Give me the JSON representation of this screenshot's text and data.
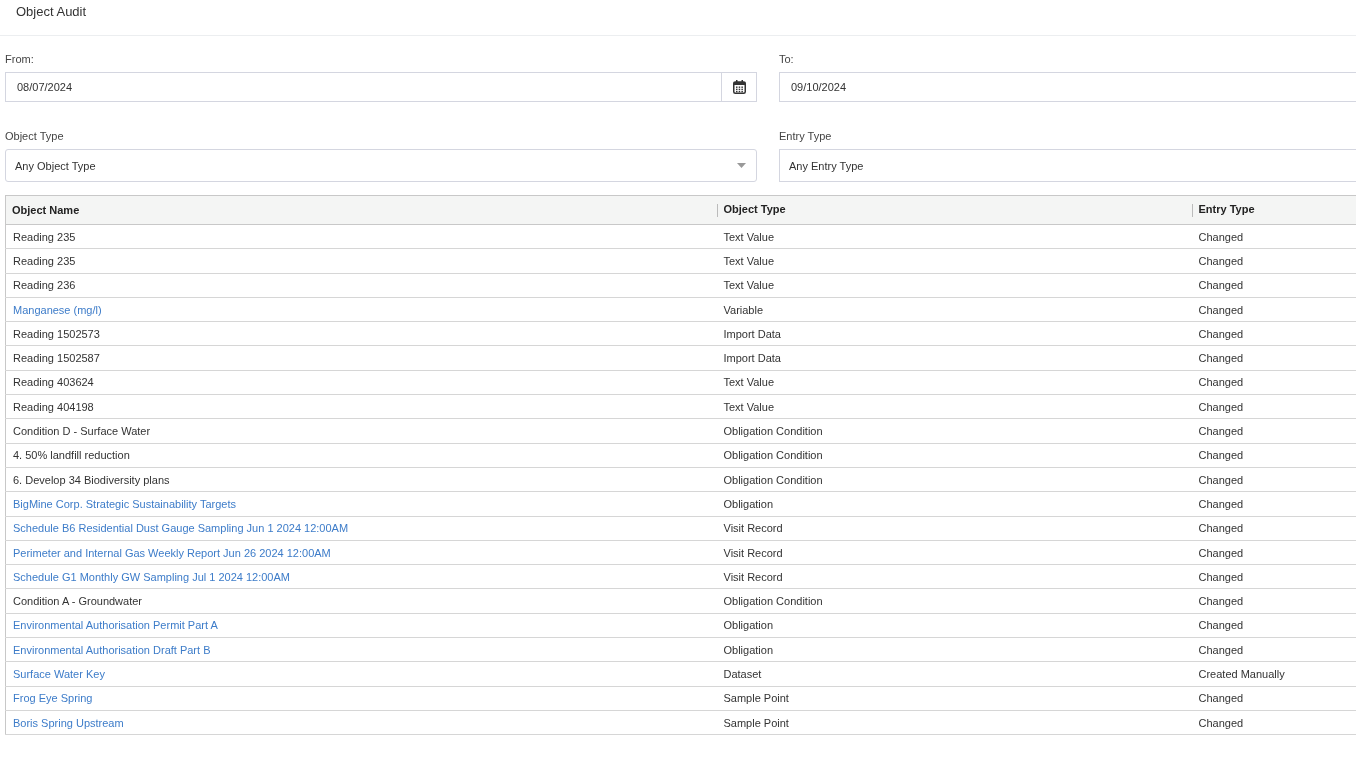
{
  "page": {
    "title": "Object Audit"
  },
  "filters": {
    "from": {
      "label": "From:",
      "value": "08/07/2024"
    },
    "to": {
      "label": "To:",
      "value": "09/10/2024"
    },
    "object_type": {
      "label": "Object Type",
      "value": "Any Object Type"
    },
    "entry_type": {
      "label": "Entry Type",
      "value": "Any Entry Type"
    }
  },
  "table": {
    "columns": [
      "Object Name",
      "Object Type",
      "Entry Type"
    ],
    "rows": [
      {
        "name": "Reading 235",
        "link": false,
        "object_type": "Text Value",
        "entry_type": "Changed"
      },
      {
        "name": "Reading 235",
        "link": false,
        "object_type": "Text Value",
        "entry_type": "Changed"
      },
      {
        "name": "Reading 236",
        "link": false,
        "object_type": "Text Value",
        "entry_type": "Changed"
      },
      {
        "name": "Manganese (mg/l)",
        "link": true,
        "object_type": "Variable",
        "entry_type": "Changed"
      },
      {
        "name": "Reading 1502573",
        "link": false,
        "object_type": "Import Data",
        "entry_type": "Changed"
      },
      {
        "name": "Reading 1502587",
        "link": false,
        "object_type": "Import Data",
        "entry_type": "Changed"
      },
      {
        "name": "Reading 403624",
        "link": false,
        "object_type": "Text Value",
        "entry_type": "Changed"
      },
      {
        "name": "Reading 404198",
        "link": false,
        "object_type": "Text Value",
        "entry_type": "Changed"
      },
      {
        "name": "Condition D - Surface Water",
        "link": false,
        "object_type": "Obligation Condition",
        "entry_type": "Changed"
      },
      {
        "name": "4. 50% landfill reduction",
        "link": false,
        "object_type": "Obligation Condition",
        "entry_type": "Changed"
      },
      {
        "name": "6. Develop 34 Biodiversity plans",
        "link": false,
        "object_type": "Obligation Condition",
        "entry_type": "Changed"
      },
      {
        "name": "BigMine Corp. Strategic Sustainability Targets",
        "link": true,
        "object_type": "Obligation",
        "entry_type": "Changed"
      },
      {
        "name": "Schedule B6 Residential Dust Gauge Sampling Jun 1 2024 12:00AM",
        "link": true,
        "object_type": "Visit Record",
        "entry_type": "Changed"
      },
      {
        "name": "Perimeter and Internal Gas Weekly Report Jun 26 2024 12:00AM",
        "link": true,
        "object_type": "Visit Record",
        "entry_type": "Changed"
      },
      {
        "name": "Schedule G1 Monthly GW Sampling Jul 1 2024 12:00AM",
        "link": true,
        "object_type": "Visit Record",
        "entry_type": "Changed"
      },
      {
        "name": "Condition A - Groundwater",
        "link": false,
        "object_type": "Obligation Condition",
        "entry_type": "Changed"
      },
      {
        "name": "Environmental Authorisation Permit Part A",
        "link": true,
        "object_type": "Obligation",
        "entry_type": "Changed"
      },
      {
        "name": "Environmental Authorisation Draft Part B",
        "link": true,
        "object_type": "Obligation",
        "entry_type": "Changed"
      },
      {
        "name": "Surface Water Key",
        "link": true,
        "object_type": "Dataset",
        "entry_type": "Created Manually"
      },
      {
        "name": "Frog Eye Spring",
        "link": true,
        "object_type": "Sample Point",
        "entry_type": "Changed"
      },
      {
        "name": "Boris Spring Upstream",
        "link": true,
        "object_type": "Sample Point",
        "entry_type": "Changed"
      }
    ]
  }
}
